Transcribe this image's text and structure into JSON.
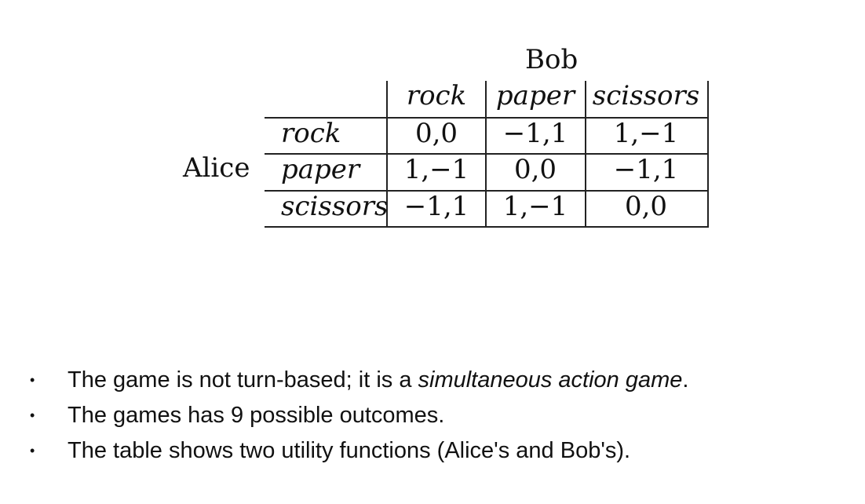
{
  "table": {
    "column_player": "Bob",
    "row_player": "Alice",
    "columns": [
      "rock",
      "paper",
      "scissors"
    ],
    "rows": [
      {
        "label": "rock",
        "cells": [
          "0,0",
          "−1,1",
          "1,−1"
        ]
      },
      {
        "label": "paper",
        "cells": [
          "1,−1",
          "0,0",
          "−1,1"
        ]
      },
      {
        "label": "scissors",
        "cells": [
          "−1,1",
          "1,−1",
          "0,0"
        ]
      }
    ]
  },
  "bullets": [
    {
      "prefix": "The game is not turn-based; it is a ",
      "emphasis": "simultaneous action game",
      "suffix": "."
    },
    {
      "text": "The games has 9 possible outcomes."
    },
    {
      "text": "The table shows two utility functions (Alice's and Bob's)."
    }
  ]
}
